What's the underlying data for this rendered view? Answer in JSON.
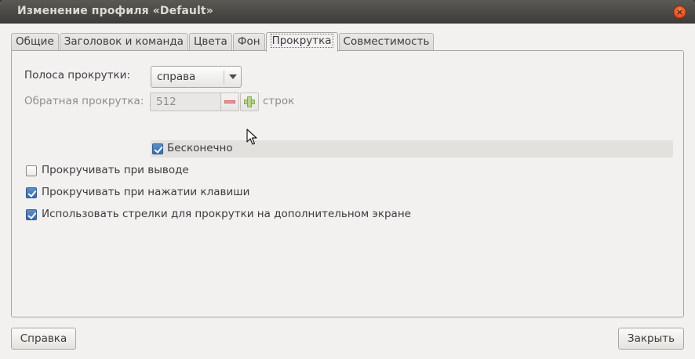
{
  "window": {
    "title": "Изменение профиля «Default»",
    "close_glyph": "×"
  },
  "tabs": [
    {
      "label": "Общие",
      "active": false
    },
    {
      "label": "Заголовок и команда",
      "active": false
    },
    {
      "label": "Цвета",
      "active": false
    },
    {
      "label": "Фон",
      "active": false
    },
    {
      "label": "Прокрутка",
      "active": true
    },
    {
      "label": "Совместимость",
      "active": false
    }
  ],
  "scrolling": {
    "scrollbar_label": "Полоса прокрутки:",
    "scrollbar_value": "справа",
    "scrollback_label": "Обратная прокрутка:",
    "scrollback_value": "512",
    "scrollback_unit": "строк",
    "infinite_label": "Бесконечно",
    "infinite_checked": true,
    "scroll_on_output_label": "Прокручивать при выводе",
    "scroll_on_output_checked": false,
    "scroll_on_keystroke_label": "Прокручивать при нажатии клавиши",
    "scroll_on_keystroke_checked": true,
    "alt_screen_label": "Использовать стрелки для прокрутки на дополнительном экране",
    "alt_screen_checked": true
  },
  "buttons": {
    "help_label": "Справка",
    "close_label": "Закрыть"
  },
  "icons": {
    "minus": "minus-icon",
    "plus": "plus-icon",
    "dropdown": "chevron-down-icon",
    "cursor": "mouse-pointer-icon"
  },
  "colors": {
    "titlebar": "#3e3d39",
    "close_button": "#de4a1c",
    "checkbox_checked": "#3a6aab",
    "window_bg": "#f2f1f0"
  }
}
